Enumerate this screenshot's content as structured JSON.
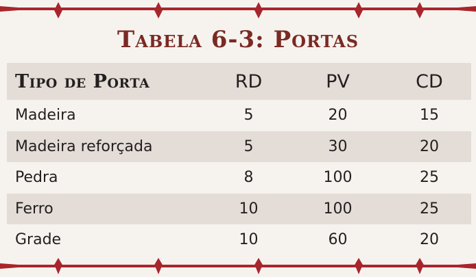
{
  "title": "Tabela 6-3: Portas",
  "columns": {
    "type": "Tipo de Porta",
    "rd": "RD",
    "pv": "PV",
    "cd": "CD"
  },
  "rows": [
    {
      "type": "Madeira",
      "rd": "5",
      "pv": "20",
      "cd": "15"
    },
    {
      "type": "Madeira reforçada",
      "rd": "5",
      "pv": "30",
      "cd": "20"
    },
    {
      "type": "Pedra",
      "rd": "8",
      "pv": "100",
      "cd": "25"
    },
    {
      "type": "Ferro",
      "rd": "10",
      "pv": "100",
      "cd": "25"
    },
    {
      "type": "Grade",
      "rd": "10",
      "pv": "60",
      "cd": "20"
    }
  ],
  "colors": {
    "title": "#7a2a24",
    "border": "#a8262b",
    "shaded_row": "#e3dcd7",
    "background": "#f6f3ef"
  }
}
